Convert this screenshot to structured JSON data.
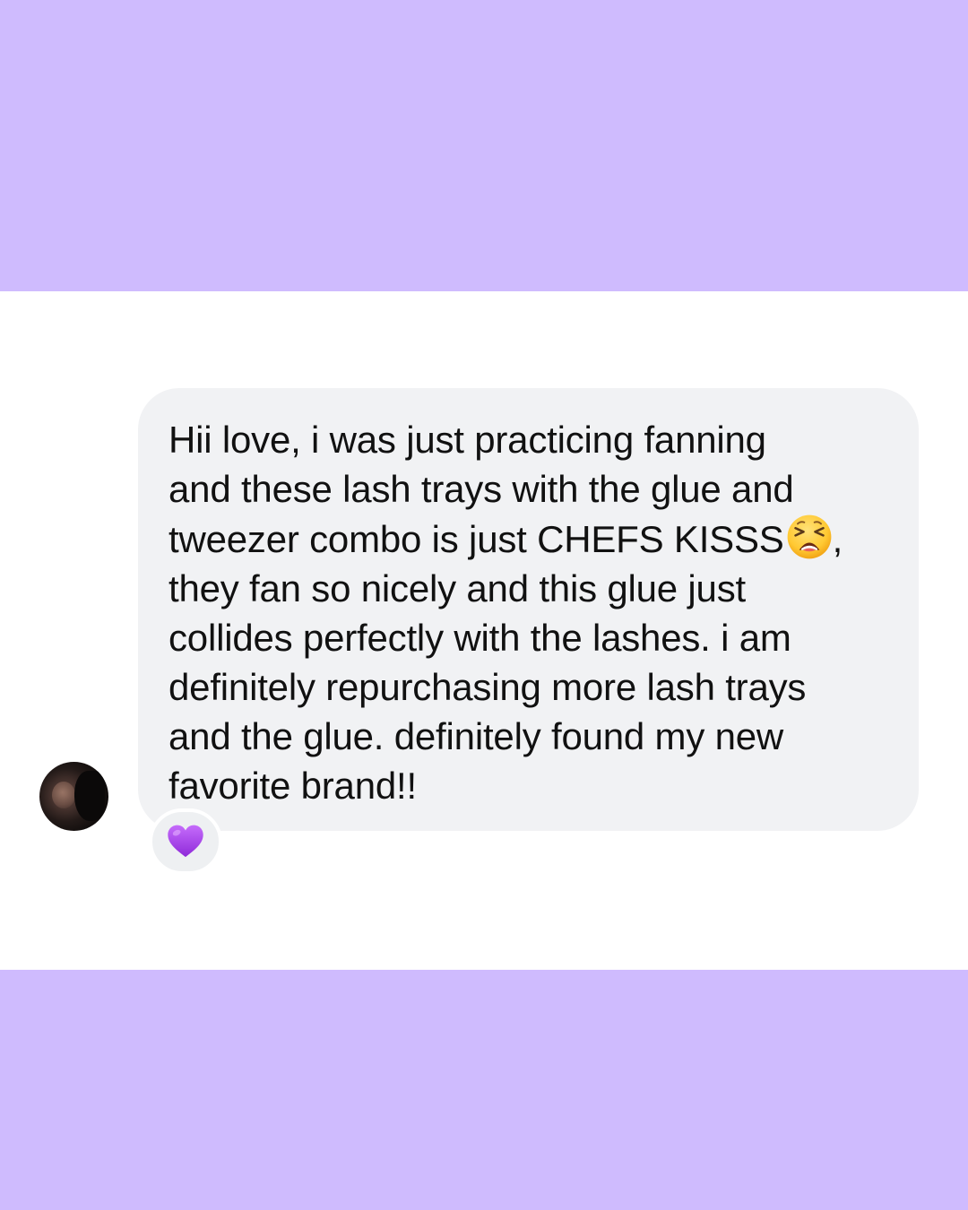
{
  "colors": {
    "band": "#cfbbfe",
    "bubble": "#f1f2f4",
    "text": "#111111",
    "heart": "#a43df0"
  },
  "message": {
    "lines": [
      "Hii love, i was just practicing fanning",
      "and these lash trays with the glue and",
      "tweezer combo is just CHEFS KISSS",
      "they fan so nicely and this glue just",
      "collides perfectly with the lashes. i am",
      "definitely repurchasing more lash trays",
      "and the glue. definitely found my new",
      "favorite brand!!"
    ],
    "line3_suffix": ",",
    "inline_emoji": "tired-face-icon"
  },
  "reaction": {
    "emoji": "purple-heart-icon"
  },
  "sender": {
    "avatar": "avatar"
  }
}
